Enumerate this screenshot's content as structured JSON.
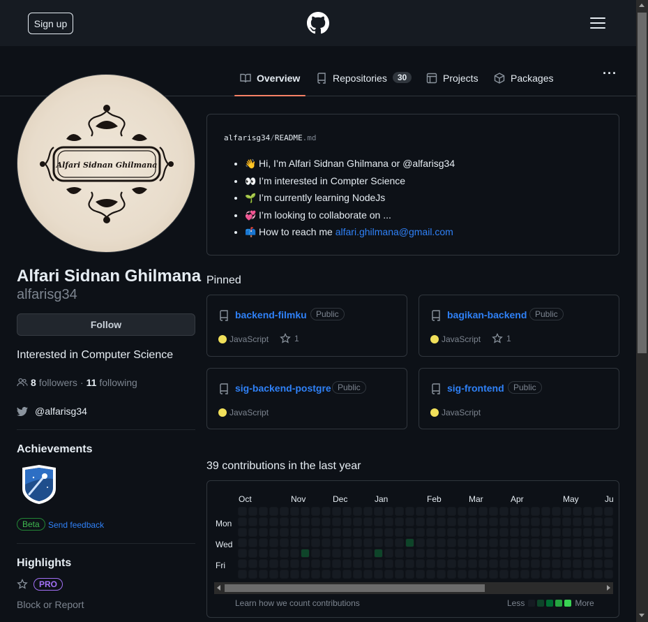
{
  "header": {
    "signup_label": "Sign up"
  },
  "tabs": [
    {
      "label": "Overview",
      "active": true
    },
    {
      "label": "Repositories",
      "count": "30"
    },
    {
      "label": "Projects"
    },
    {
      "label": "Packages"
    }
  ],
  "profile": {
    "full_name": "Alfari Sidnan Ghilmana",
    "login": "alfarisg34",
    "avatar_text": "Alfari Sidnan Ghilmana",
    "follow_label": "Follow",
    "bio": "Interested in Computer Science",
    "followers_count": "8",
    "followers_label": "followers",
    "dot": "·",
    "following_count": "11",
    "following_label": "following",
    "twitter": "@alfarisg34"
  },
  "achievements": {
    "title": "Achievements",
    "beta_label": "Beta",
    "feedback_label": "Send feedback"
  },
  "highlights": {
    "title": "Highlights",
    "pro_label": "PRO",
    "block_label": "Block or Report"
  },
  "readme": {
    "owner": "alfarisg34",
    "slash": "/",
    "file": "README",
    "ext": ".md",
    "items": [
      {
        "emoji": "👋",
        "text": "Hi, I’m Alfari Sidnan Ghilmana or @alfarisg34"
      },
      {
        "emoji": "👀",
        "text": "I’m interested in Compter Science"
      },
      {
        "emoji": "🌱",
        "text": "I’m currently learning NodeJs"
      },
      {
        "emoji": "💞️",
        "text": "I’m looking to collaborate on ..."
      },
      {
        "emoji": "📫",
        "text": "How to reach me ",
        "link": "alfari.ghilmana@gmail.com"
      }
    ]
  },
  "pinned": {
    "title": "Pinned",
    "repos": [
      {
        "name": "backend-filmku",
        "visibility": "Public",
        "language": "JavaScript",
        "stars": "1"
      },
      {
        "name": "bagikan-backend",
        "visibility": "Public",
        "language": "JavaScript",
        "stars": "1"
      },
      {
        "name": "sig-backend-postgre",
        "visibility": "Public",
        "language": "JavaScript"
      },
      {
        "name": "sig-frontend",
        "visibility": "Public",
        "language": "JavaScript"
      }
    ]
  },
  "contributions": {
    "title": "39 contributions in the last year",
    "months": [
      "Oct",
      "Nov",
      "Dec",
      "Jan",
      "Feb",
      "Mar",
      "Apr",
      "May",
      "Ju"
    ],
    "days": [
      "Mon",
      "Wed",
      "Fri"
    ],
    "learn_label": "Learn how we count contributions",
    "less_label": "Less",
    "more_label": "More",
    "legend_colors": [
      "#161b22",
      "#0e4429",
      "#006d32",
      "#26a641",
      "#39d353"
    ],
    "active_cells": [
      {
        "week": 6,
        "day": 4,
        "level": 1
      },
      {
        "week": 13,
        "day": 4,
        "level": 1
      },
      {
        "week": 16,
        "day": 3,
        "level": 1
      }
    ]
  },
  "colors": {
    "accent": "#2f81f7",
    "tab_underline": "#f78166",
    "language_js": "#f1e05a"
  }
}
